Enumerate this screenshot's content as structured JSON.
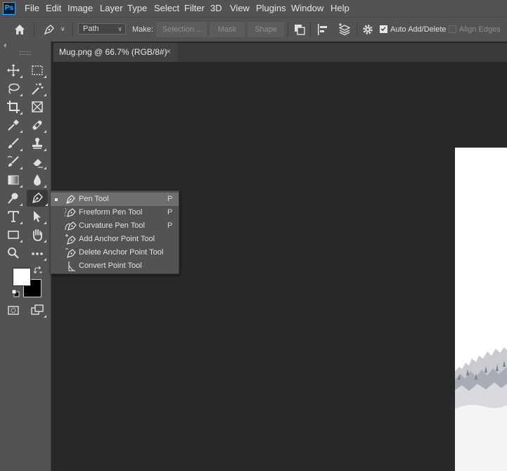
{
  "app": {
    "logo": "Ps"
  },
  "menu": [
    "File",
    "Edit",
    "Image",
    "Layer",
    "Type",
    "Select",
    "Filter",
    "3D",
    "View",
    "Plugins",
    "Window",
    "Help"
  ],
  "options_bar": {
    "mode_select": "Path",
    "make_label": "Make:",
    "selection_button": "Selection...",
    "mask_button": "Mask",
    "shape_button": "Shape",
    "auto_add_delete": {
      "label": "Auto Add/Delete",
      "checked": true
    },
    "align_edges": {
      "label": "Align Edges",
      "checked": false
    }
  },
  "tools_panel": {
    "collapse_glyph": "‹‹",
    "icons": [
      "move-icon",
      "marquee-icon",
      "lasso-icon",
      "magic-wand-icon",
      "crop-icon",
      "frame-icon",
      "eyedropper-icon",
      "healing-brush-icon",
      "brush-icon",
      "stamp-icon",
      "history-brush-icon",
      "eraser-icon",
      "gradient-icon",
      "blur-icon",
      "dodge-icon",
      "pen-icon",
      "type-icon",
      "path-selection-icon",
      "rectangle-icon",
      "hand-icon",
      "zoom-icon",
      "more-tools-icon",
      "quick-mask-icon",
      "screen-mode-icon"
    ],
    "foreground_color": "#ffffff",
    "background_color": "#000000"
  },
  "document": {
    "tab_title": "Mug.png @ 66.7% (RGB/8#)",
    "close_glyph": "×"
  },
  "flyout": {
    "items": [
      {
        "label": "Pen Tool",
        "shortcut": "P",
        "selected": true,
        "icon": "pen-icon"
      },
      {
        "label": "Freeform Pen Tool",
        "shortcut": "P",
        "selected": false,
        "icon": "freeform-pen-icon"
      },
      {
        "label": "Curvature Pen Tool",
        "shortcut": "P",
        "selected": false,
        "icon": "curvature-pen-icon"
      },
      {
        "label": "Add Anchor Point Tool",
        "shortcut": "",
        "selected": false,
        "icon": "add-anchor-point-icon"
      },
      {
        "label": "Delete Anchor Point Tool",
        "shortcut": "",
        "selected": false,
        "icon": "delete-anchor-point-icon"
      },
      {
        "label": "Convert Point Tool",
        "shortcut": "",
        "selected": false,
        "icon": "convert-point-icon"
      }
    ]
  },
  "colors": {
    "ui_panel": "#535353",
    "workspace": "#282828",
    "accent": "#31a8ff"
  }
}
